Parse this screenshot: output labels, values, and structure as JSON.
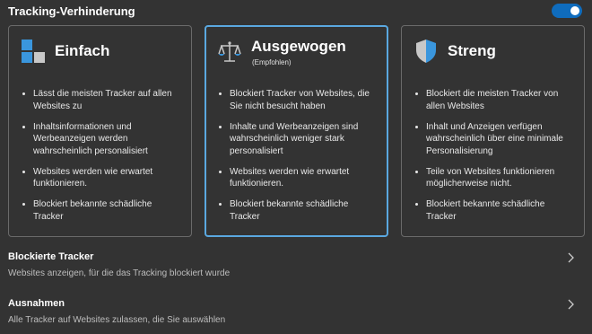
{
  "header": {
    "title": "Tracking-Verhinderung",
    "toggle_state": "on"
  },
  "cards": [
    {
      "title": "Einfach",
      "subtitle": "",
      "icon": "basic-blocks-icon",
      "selected": false,
      "bullets": [
        "Lässt die meisten Tracker auf allen Websites zu",
        "Inhaltsinformationen und Werbeanzeigen werden wahrscheinlich personalisiert",
        "Websites werden wie erwartet funktionieren.",
        "Blockiert bekannte schädliche Tracker"
      ]
    },
    {
      "title": "Ausgewogen",
      "subtitle": "(Empfohlen)",
      "icon": "balance-scale-icon",
      "selected": true,
      "bullets": [
        "Blockiert Tracker von Websites, die Sie nicht besucht haben",
        "Inhalte und Werbeanzeigen sind wahrscheinlich weniger stark personalisiert",
        "Websites werden wie erwartet funktionieren.",
        "Blockiert bekannte schädliche Tracker"
      ]
    },
    {
      "title": "Streng",
      "subtitle": "",
      "icon": "shield-icon",
      "selected": false,
      "bullets": [
        "Blockiert die meisten Tracker von allen Websites",
        "Inhalt und Anzeigen verfügen wahrscheinlich über eine minimale Personalisierung",
        "Teile von Websites funktionieren möglicherweise nicht.",
        "Blockiert bekannte schädliche Tracker"
      ]
    }
  ],
  "rows": {
    "blocked": {
      "title": "Blockierte Tracker",
      "description": "Websites anzeigen, für die das Tracking blockiert wurde"
    },
    "exceptions": {
      "title": "Ausnahmen",
      "description": "Alle Tracker auf Websites zulassen, die Sie auswählen"
    }
  },
  "colors": {
    "accent": "#0f6cbd",
    "selected_border": "#5aa8e0",
    "background": "#333333"
  }
}
